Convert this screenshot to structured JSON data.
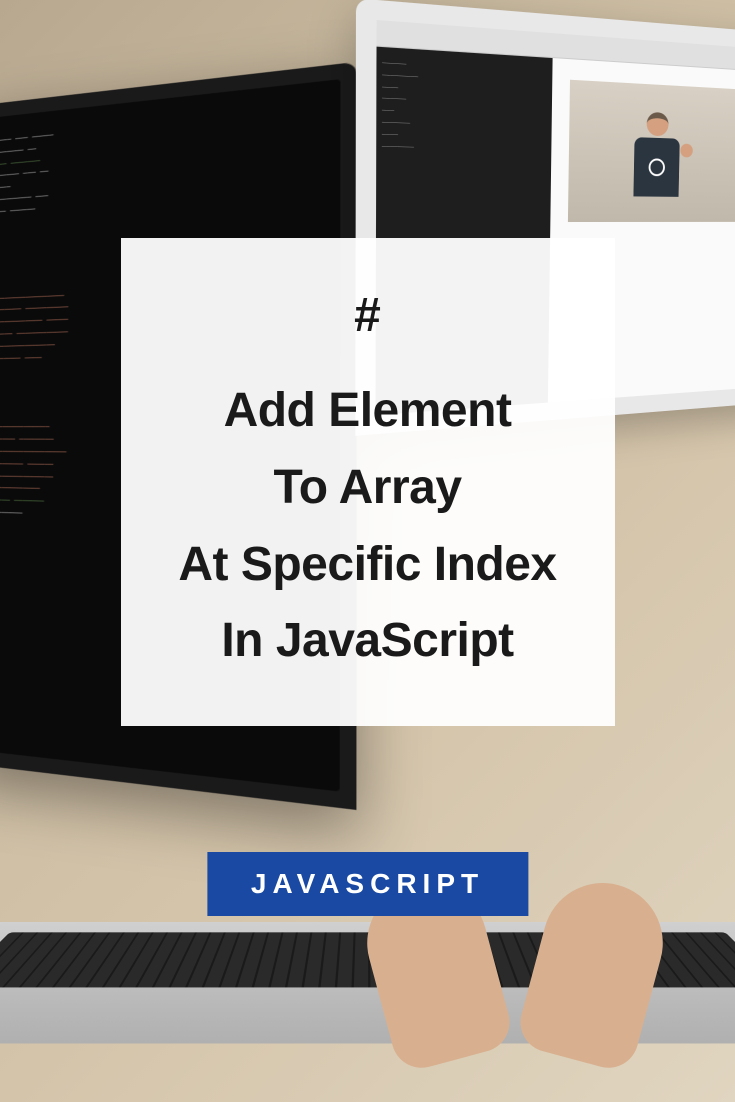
{
  "card": {
    "hash": "#",
    "line1": "Add Element",
    "line2": "To Array",
    "line3": "At Specific Index",
    "line4": "In JavaScript"
  },
  "badge": {
    "label": "JAVASCRIPT"
  },
  "colors": {
    "badge_bg": "#1949a3",
    "badge_text": "#ffffff",
    "card_bg": "rgba(255,255,255,0.95)",
    "text": "#1a1a1a"
  }
}
